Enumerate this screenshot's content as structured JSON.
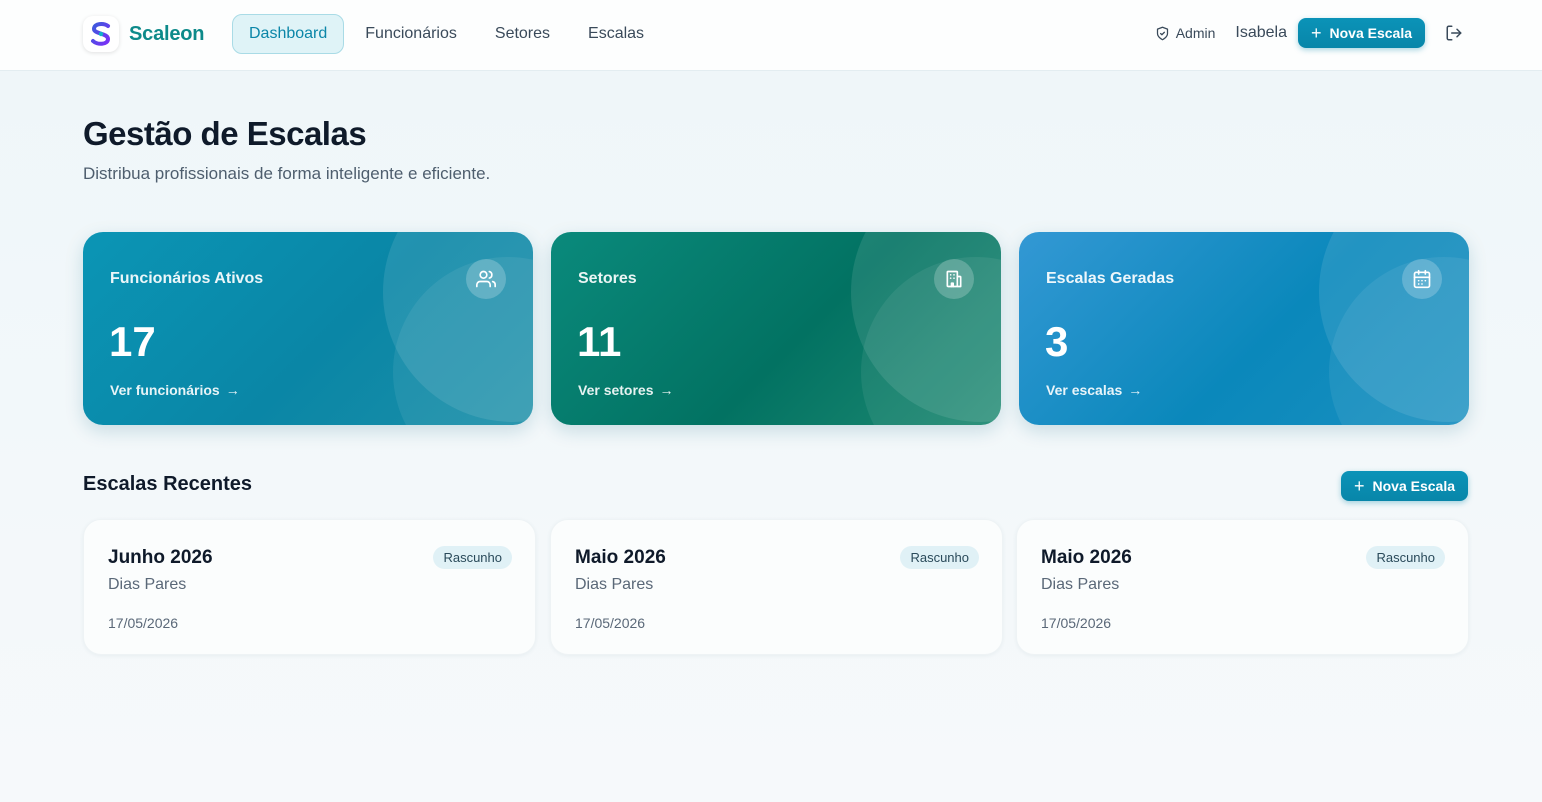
{
  "header": {
    "brand": "Scaleon",
    "nav": [
      {
        "label": "Dashboard",
        "active": true
      },
      {
        "label": "Funcionários",
        "active": false
      },
      {
        "label": "Setores",
        "active": false
      },
      {
        "label": "Escalas",
        "active": false
      }
    ],
    "role_badge": "Admin",
    "user_name": "Isabela",
    "new_button_label": "Nova Escala",
    "icons": {
      "logo": "scaleon-logo-icon",
      "role": "shield-icon",
      "logout": "logout-icon",
      "add": "plus-icon"
    }
  },
  "page": {
    "title": "Gestão de Escalas",
    "subtitle": "Distribua profissionais de forma inteligente e eficiente."
  },
  "stats": [
    {
      "label": "Funcionários Ativos",
      "value": "17",
      "link": "Ver funcionários",
      "icon": "users-icon",
      "color": "#0a8fb0"
    },
    {
      "label": "Setores",
      "value": "11",
      "link": "Ver setores",
      "icon": "building-icon",
      "color": "#047a69"
    },
    {
      "label": "Escalas Geradas",
      "value": "3",
      "link": "Ver escalas",
      "icon": "calendar-icon",
      "color": "#1a8fc6"
    }
  ],
  "recent": {
    "title": "Escalas Recentes",
    "new_button_label": "Nova Escala",
    "items": [
      {
        "name": "Junho 2026",
        "type": "Dias Pares",
        "date": "17/05/2026",
        "status": "Rascunho"
      },
      {
        "name": "Maio 2026",
        "type": "Dias Pares",
        "date": "17/05/2026",
        "status": "Rascunho"
      },
      {
        "name": "Maio 2026",
        "type": "Dias Pares",
        "date": "17/05/2026",
        "status": "Rascunho"
      }
    ]
  },
  "colors": {
    "accent": "#0886a9",
    "brand_text": "#0d8a8a",
    "status_badge_bg": "#e0f1f6"
  }
}
